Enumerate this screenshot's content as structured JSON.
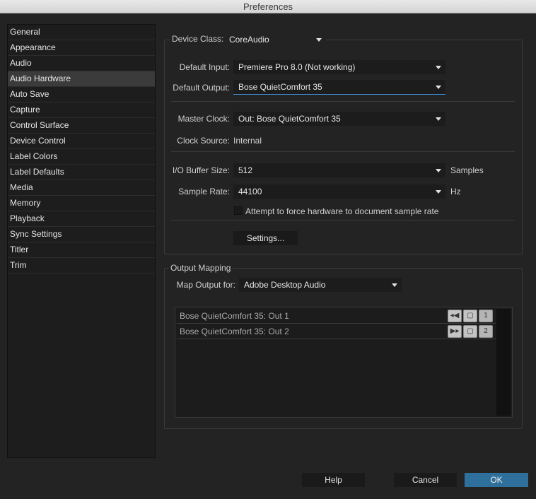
{
  "window": {
    "title": "Preferences"
  },
  "sidebar": {
    "items": [
      {
        "label": "General"
      },
      {
        "label": "Appearance"
      },
      {
        "label": "Audio"
      },
      {
        "label": "Audio Hardware"
      },
      {
        "label": "Auto Save"
      },
      {
        "label": "Capture"
      },
      {
        "label": "Control Surface"
      },
      {
        "label": "Device Control"
      },
      {
        "label": "Label Colors"
      },
      {
        "label": "Label Defaults"
      },
      {
        "label": "Media"
      },
      {
        "label": "Memory"
      },
      {
        "label": "Playback"
      },
      {
        "label": "Sync Settings"
      },
      {
        "label": "Titler"
      },
      {
        "label": "Trim"
      }
    ],
    "selected": "Audio Hardware"
  },
  "device": {
    "class_label": "Device Class:",
    "class_value": "CoreAudio",
    "default_input_label": "Default Input:",
    "default_input_value": "Premiere Pro 8.0 (Not working)",
    "default_output_label": "Default Output:",
    "default_output_value": "Bose QuietComfort 35",
    "master_clock_label": "Master Clock:",
    "master_clock_value": "Out: Bose QuietComfort 35",
    "clock_source_label": "Clock Source:",
    "clock_source_value": "Internal",
    "io_buffer_label": "I/O Buffer Size:",
    "io_buffer_value": "512",
    "io_buffer_unit": "Samples",
    "sample_rate_label": "Sample Rate:",
    "sample_rate_value": "44100",
    "sample_rate_unit": "Hz",
    "force_rate_label": "Attempt to force hardware to document sample rate",
    "force_rate_checked": false,
    "settings_button": "Settings..."
  },
  "output_mapping": {
    "legend": "Output Mapping",
    "map_for_label": "Map Output for:",
    "map_for_value": "Adobe Desktop Audio",
    "rows": [
      {
        "label": "Bose QuietComfort 35: Out 1",
        "channel": "1",
        "icon": "speaker-left-icon"
      },
      {
        "label": "Bose QuietComfort 35: Out 2",
        "channel": "2",
        "icon": "speaker-right-icon"
      }
    ]
  },
  "footer": {
    "help": "Help",
    "cancel": "Cancel",
    "ok": "OK"
  },
  "colors": {
    "background": "#232323",
    "accent": "#2f6f9b",
    "focus": "#3d8fd4"
  }
}
